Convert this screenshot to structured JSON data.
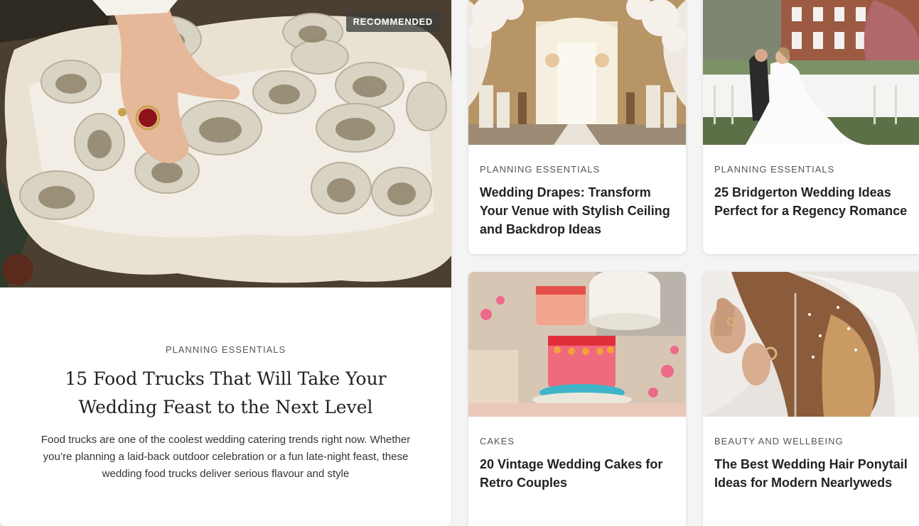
{
  "featured": {
    "badge": "RECOMMENDED",
    "category": "PLANNING ESSENTIALS",
    "title": "15 Food Trucks That Will Take Your Wedding Feast to the Next Level",
    "excerpt": "Food trucks are one of the coolest wedding catering trends right now. Whether you’re planning a laid-back outdoor celebration or a fun late-night feast, these wedding food trucks deliver serious flavour and style",
    "image": "oysters-on-ice-photo"
  },
  "cards": [
    {
      "category": "PLANNING ESSENTIALS",
      "title": "Wedding Drapes: Transform Your Venue with Stylish Ceiling and Backdrop Ideas",
      "image": "draped-ceremony-aisle-photo"
    },
    {
      "category": "PLANNING ESSENTIALS",
      "title": "25 Bridgerton Wedding Ideas Perfect for a Regency Romance",
      "image": "couple-at-garden-table-photo"
    },
    {
      "category": "CAKES",
      "title": "20 Vintage Wedding Cakes for Retro Couples",
      "image": "pink-vintage-cakes-photo"
    },
    {
      "category": "BEAUTY AND WELLBEING",
      "title": "The Best Wedding Hair Ponytail Ideas for Modern Nearlyweds",
      "image": "bride-ponytail-veil-photo"
    }
  ]
}
